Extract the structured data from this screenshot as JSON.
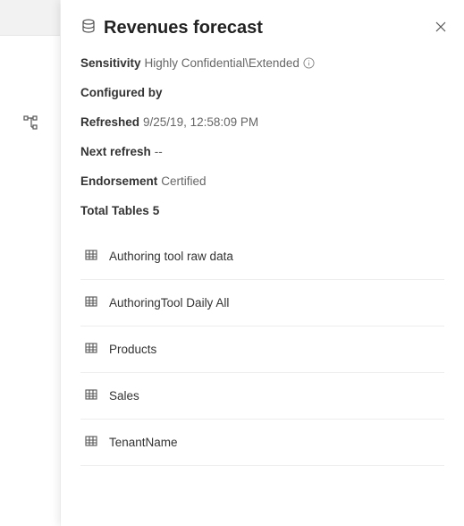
{
  "panel": {
    "title": "Revenues forecast",
    "sensitivity_label": "Sensitivity",
    "sensitivity_value": "Highly Confidential\\Extended",
    "configured_label": "Configured by",
    "configured_value": "",
    "refreshed_label": "Refreshed",
    "refreshed_value": "9/25/19, 12:58:09 PM",
    "next_refresh_label": "Next refresh",
    "next_refresh_value": "--",
    "endorsement_label": "Endorsement",
    "endorsement_value": "Certified",
    "total_tables_label": "Total Tables",
    "total_tables_value": "5",
    "tables": [
      {
        "name": "Authoring tool raw data"
      },
      {
        "name": "AuthoringTool Daily All"
      },
      {
        "name": "Products"
      },
      {
        "name": "Sales"
      },
      {
        "name": "TenantName"
      }
    ]
  }
}
